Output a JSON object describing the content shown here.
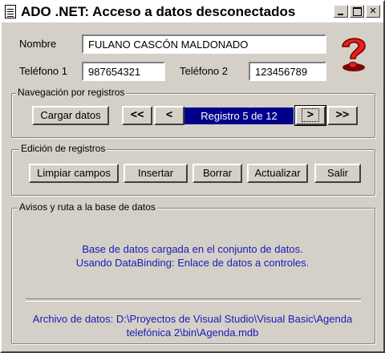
{
  "window": {
    "title": "ADO .NET: Acceso a datos desconectados"
  },
  "form": {
    "nombre_label": "Nombre",
    "nombre_value": "FULANO CASCÓN MALDONADO",
    "telefono1_label": "Teléfono 1",
    "telefono1_value": "987654321",
    "telefono2_label": "Teléfono 2",
    "telefono2_value": "123456789",
    "help_icon": "question-mark-icon",
    "help_icon_color": "#e8201a"
  },
  "navegacion": {
    "title": "Navegación por registros",
    "cargar_label": "Cargar datos",
    "first_label": "<<",
    "prev_label": "<",
    "record_label": "Registro 5 de 12",
    "next_label": ">",
    "last_label": ">>"
  },
  "edicion": {
    "title": "Edición de registros",
    "limpiar_label": "Limpiar campos",
    "insertar_label": "Insertar",
    "borrar_label": "Borrar",
    "actualizar_label": "Actualizar",
    "salir_label": "Salir"
  },
  "avisos": {
    "title": "Avisos y ruta a la base de datos",
    "message_line1": "Base de datos cargada en el conjunto de datos.",
    "message_line2": "Usando DataBinding: Enlace de datos a controles.",
    "path_line1": "Archivo de datos: D:\\Proyectos de Visual Studio\\Visual Basic\\Agenda",
    "path_line2": "telefónica 2\\bin\\Agenda.mdb",
    "text_color": "#1a1ab4"
  }
}
